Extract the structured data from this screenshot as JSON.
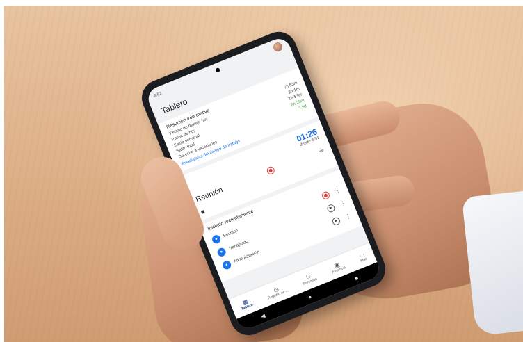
{
  "status": {
    "time": "8:52"
  },
  "title": "Tablero",
  "summary": {
    "heading": "Resumen informativo",
    "rows": [
      {
        "label": "Tiempo de trabajo hoy",
        "value": "7h 53m",
        "color": "#333333"
      },
      {
        "label": "Pausa de hoy",
        "value": "2h 1m",
        "color": "#333333"
      },
      {
        "label": "Saldo semanal",
        "value": "7h 53m",
        "color": "#333333"
      },
      {
        "label": "Saldo total",
        "value": "6h 20m",
        "color": "#3aa53a"
      },
      {
        "label": "Derecho a vacaciones",
        "value": "7.5d",
        "color": "#3aa53a"
      }
    ],
    "link": "Estadísticas del tiempo de trabajo"
  },
  "timer": {
    "clock": "01:26",
    "since": "desde 8:51"
  },
  "current": {
    "activity": "Reunión"
  },
  "recent": {
    "heading": "Iniciado recientemente",
    "items": [
      {
        "label": "Reunión"
      },
      {
        "label": "Trabajando"
      },
      {
        "label": "Administración"
      }
    ]
  },
  "nav": [
    {
      "label": "Tablero",
      "icon": "grid-icon"
    },
    {
      "label": "Registro de ...",
      "icon": "timer-icon"
    },
    {
      "label": "Personas",
      "icon": "people-icon"
    },
    {
      "label": "Ausencia",
      "icon": "calendar-icon"
    },
    {
      "label": "Más",
      "icon": "more-icon"
    }
  ],
  "colors": {
    "accent": "#1a73e8",
    "record": "#e53935",
    "positive": "#3aa53a"
  }
}
